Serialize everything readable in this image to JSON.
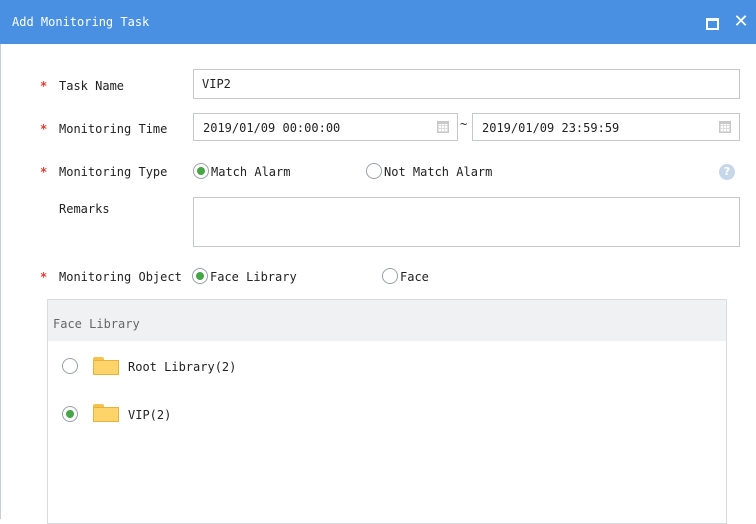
{
  "dialog": {
    "title": "Add Monitoring Task",
    "maximize_icon": "maximize-icon",
    "close_icon": "close-icon",
    "close_glyph": "✕"
  },
  "form": {
    "required_mark": "*",
    "task_name": {
      "label": "Task Name",
      "value": "VIP2"
    },
    "monitoring_time": {
      "label": "Monitoring Time",
      "start": "2019/01/09 00:00:00",
      "separator": "~",
      "end": "2019/01/09 23:59:59",
      "calendar_icon": "calendar-icon"
    },
    "monitoring_type": {
      "label": "Monitoring Type",
      "options": [
        "Match Alarm",
        "Not Match Alarm"
      ],
      "selected": "Match Alarm",
      "help_glyph": "?"
    },
    "remarks": {
      "label": "Remarks",
      "value": ""
    },
    "monitoring_object": {
      "label": "Monitoring Object",
      "options": [
        "Face Library",
        "Face"
      ],
      "selected": "Face Library"
    }
  },
  "face_library_panel": {
    "title": "Face Library",
    "items": [
      {
        "label": "Root Library(2)",
        "selected": false,
        "icon": "folder-icon"
      },
      {
        "label": "VIP(2)",
        "selected": true,
        "icon": "folder-icon"
      }
    ]
  },
  "colors": {
    "title_bar": "#4a90e2",
    "required": "#e23b2e",
    "radio_checked": "#47a447",
    "panel_header": "#f0f1f3"
  }
}
